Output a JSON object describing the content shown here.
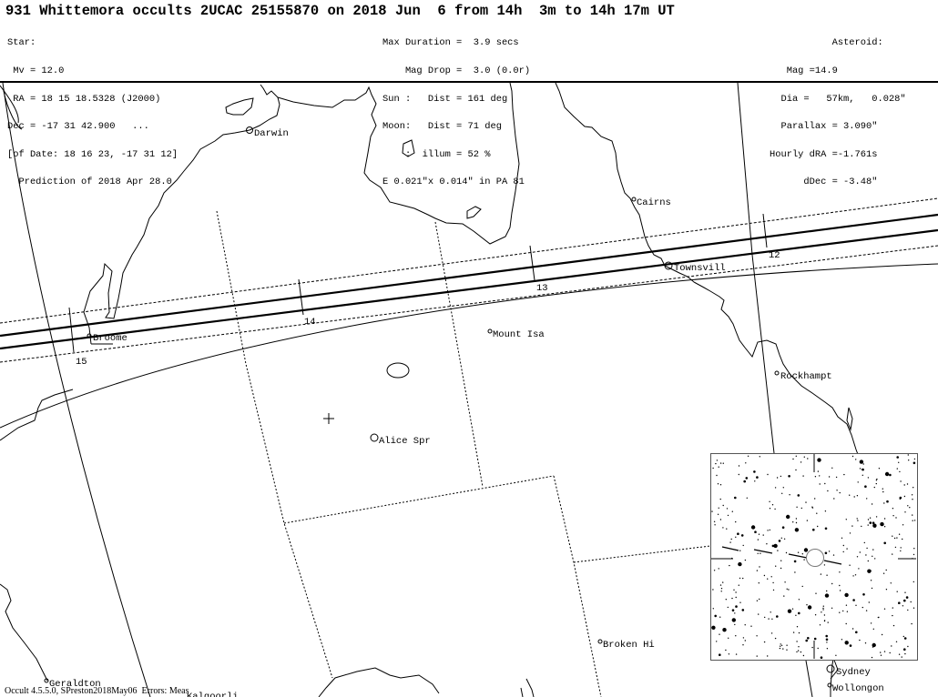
{
  "title": "931 Whittemora occults 2UCAC 25155870 on 2018 Jun  6 from 14h  3m to 14h 17m UT",
  "star": {
    "lines": [
      "Star:",
      " Mv = 12.0",
      " RA = 18 15 18.5328 (J2000)",
      "Dec = -17 31 42.900   ...",
      "[of Date: 18 16 23, -17 31 12]",
      "  Prediction of 2018 Apr 28.0"
    ]
  },
  "event": {
    "lines": [
      "Max Duration =  3.9 secs",
      "    Mag Drop =  3.0 (0.0r)",
      "Sun :   Dist = 161 deg",
      "Moon:   Dist = 71 deg",
      "    :  illum = 52 %",
      "E 0.021\"x 0.014\" in PA 81"
    ]
  },
  "asteroid": {
    "lines": [
      "Asteroid:    ",
      "Mag =14.9            ",
      "Dia =   57km,   0.028\"",
      "Parallax = 3.090\"     ",
      "Hourly dRA =-1.761s     ",
      "dDec = -3.48\"     "
    ]
  },
  "map": {
    "places": [
      {
        "name": "Darwin"
      },
      {
        "name": "Cairns"
      },
      {
        "name": "Townsvill"
      },
      {
        "name": "Broome"
      },
      {
        "name": "Mount Isa"
      },
      {
        "name": "Rockhampt"
      },
      {
        "name": "Alice Spr"
      },
      {
        "name": "Broken Hi"
      },
      {
        "name": "Sydney"
      },
      {
        "name": "Wollongon"
      },
      {
        "name": "Geraldton"
      },
      {
        "name": "Kalgoorli"
      }
    ],
    "time_ticks": [
      "12",
      "13",
      "14",
      "15"
    ],
    "star_chart": {
      "label": "star field"
    }
  },
  "footer": "Occult 4.5.5.0, SPreston2018May06  Errors: Meas"
}
